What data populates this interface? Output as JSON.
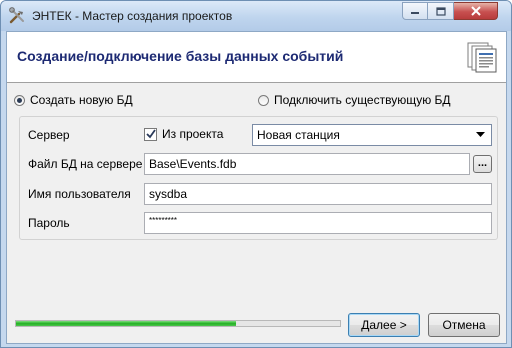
{
  "window": {
    "title": "ЭНТЕК - Мастер создания проектов",
    "icon": "tools-icon"
  },
  "header": {
    "title": "Создание/подключение базы данных событий",
    "icon": "document-pages-icon"
  },
  "mode": {
    "create_label": "Создать новую БД",
    "create_selected": true,
    "connect_label": "Подключить существующую БД",
    "connect_selected": false
  },
  "form": {
    "server_label": "Сервер",
    "from_project_label": "Из проекта",
    "from_project_checked": true,
    "server_value": "Новая станция",
    "db_file_label": "Файл БД на сервере",
    "db_file_value": "Base\\Events.fdb",
    "browse_label": "...",
    "username_label": "Имя пользователя",
    "username_value": "sysdba",
    "password_label": "Пароль",
    "password_value": "*********"
  },
  "progress": {
    "fraction": 0.68,
    "color": "#24b024"
  },
  "buttons": {
    "next_label": "Далее >",
    "cancel_label": "Отмена"
  }
}
